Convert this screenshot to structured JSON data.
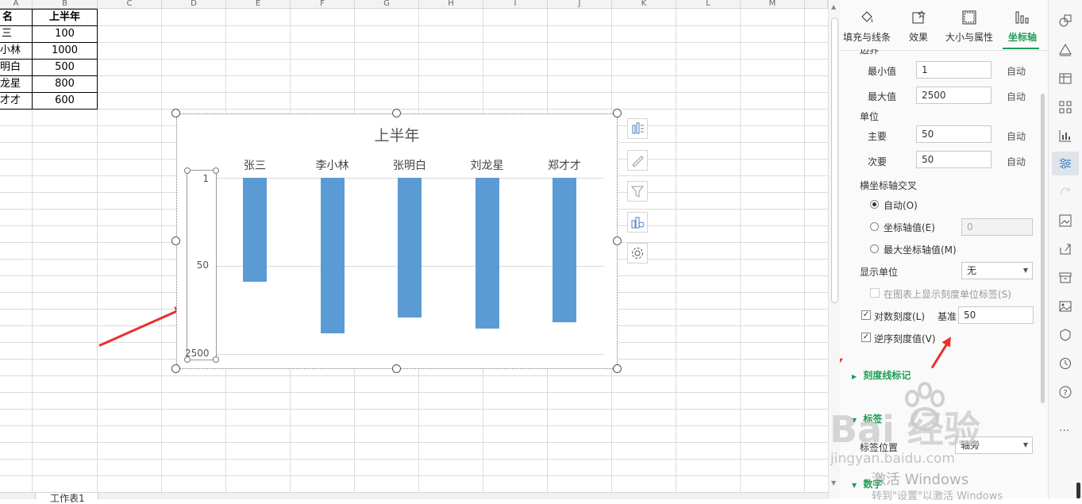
{
  "sheet": {
    "columns": [
      "A",
      "B",
      "C",
      "D",
      "E",
      "F",
      "G",
      "H",
      "I",
      "J",
      "K",
      "L",
      "M"
    ],
    "header_row": {
      "name": "名",
      "value": "上半年"
    },
    "rows": [
      {
        "name": "三",
        "value": "100"
      },
      {
        "name": "小林",
        "value": "1000"
      },
      {
        "name": "明白",
        "value": "500"
      },
      {
        "name": "龙星",
        "value": "800"
      },
      {
        "name": "才才",
        "value": "600"
      }
    ],
    "sheet_tab_label": "工作表1"
  },
  "chart_data": {
    "type": "bar",
    "title": "上半年",
    "categories": [
      "张三",
      "李小林",
      "张明白",
      "刘龙星",
      "郑才才"
    ],
    "values": [
      100,
      1000,
      500,
      800,
      600
    ],
    "y_scale": "log",
    "log_base": 50,
    "y_reversed": true,
    "ylim": [
      1,
      2500
    ],
    "y_ticks": [
      "1",
      "50",
      "2500"
    ],
    "gridlines": true,
    "color": "#5b9bd5"
  },
  "panel": {
    "tabs": [
      {
        "label": "填充与线条",
        "icon": "fill-bucket-icon"
      },
      {
        "label": "效果",
        "icon": "effects-icon"
      },
      {
        "label": "大小与属性",
        "icon": "size-icon"
      },
      {
        "label": "坐标轴",
        "icon": "axis-icon"
      }
    ],
    "partial_heading": "边界",
    "min_label": "最小值",
    "min_value": "1",
    "min_auto": "自动",
    "max_label": "最大值",
    "max_value": "2500",
    "max_auto": "自动",
    "unit_heading": "单位",
    "major_label": "主要",
    "major_value": "50",
    "major_auto": "自动",
    "minor_label": "次要",
    "minor_value": "50",
    "minor_auto": "自动",
    "cross_heading": "横坐标轴交叉",
    "cross_auto": "自动(O)",
    "cross_value": "坐标轴值(E)",
    "cross_value_input": "0",
    "cross_max": "最大坐标轴值(M)",
    "display_unit_label": "显示单位",
    "display_unit_value": "无",
    "show_unit_label": "在图表上显示刻度单位标签(S)",
    "log_scale_label": "对数刻度(L)",
    "log_base_label": "基准",
    "log_base_value": "50",
    "reverse_label": "逆序刻度值(V)",
    "tick_marks_section": "刻度线标记",
    "labels_section": "标签",
    "label_position_label": "标签位置",
    "label_position_value": "轴旁",
    "number_section": "数字"
  },
  "watermark": {
    "baidu": "Bai  经验",
    "url": "jingyan.baidu.com",
    "activate_title": "激活 Windows",
    "activate_sub": "转到\"设置\"以激活 Windows"
  },
  "colors": {
    "accent": "#1f9d55",
    "arrow": "#e8302a",
    "bar": "#5b9bd5"
  }
}
